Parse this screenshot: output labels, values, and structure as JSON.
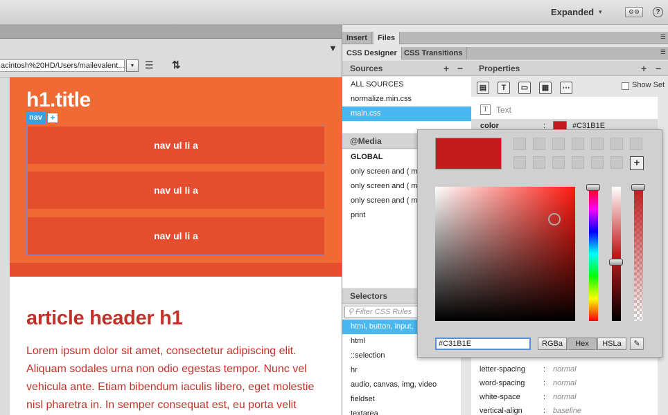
{
  "top": {
    "workspace_label": "Expanded",
    "workspace_caret": "▾",
    "sync_icon": "⚙⚙",
    "help_icon": "?"
  },
  "document": {
    "path_value": "acintosh%20HD/Users/mailevalent...",
    "dropdown_glyph": "▾",
    "filter_glyph": "▼",
    "list_glyph": "☰",
    "sort_glyph": "⇅",
    "hero_title": "h1.title",
    "nav_tag": "nav",
    "nav_plus": "+",
    "nav_items": [
      "nav ul li a",
      "nav ul li a",
      "nav ul li a"
    ],
    "article_heading": "article header h1",
    "lorem_lines": [
      "Lorem ipsum dolor sit amet, consectetur adipiscing elit.",
      "Aliquam sodales urna non odio egestas tempor. Nunc vel",
      "vehicula ante. Etiam bibendum iaculis libero, eget molestie",
      "nisl pharetra in. In semper consequat est, eu porta velit"
    ]
  },
  "panel": {
    "tabs_row1": [
      "Insert",
      "Files"
    ],
    "tabs_row2": [
      "CSS Designer",
      "CSS Transitions"
    ],
    "menu_glyph": "☰",
    "sources": {
      "title": "Sources",
      "add": "+",
      "remove": "−",
      "items": [
        "ALL SOURCES",
        "normalize.min.css",
        "main.css"
      ]
    },
    "media": {
      "title": "@Media",
      "items": [
        "GLOBAL",
        "only screen and ( m",
        "only screen and ( m",
        "only screen and ( m",
        "print"
      ]
    },
    "selectors": {
      "title": "Selectors",
      "filter_placeholder": "Filter CSS Rules",
      "items": [
        "html, button, input,",
        "html",
        "::selection",
        "hr",
        "audio, canvas, img, video",
        "fieldset",
        "textarea"
      ]
    },
    "properties": {
      "title": "Properties",
      "add": "+",
      "remove": "−",
      "show_set_label": "Show Set",
      "section_label": "Text",
      "color_name": "color",
      "color_value": "#C31B1E",
      "rows": [
        {
          "name": "letter-spacing",
          "value": "normal"
        },
        {
          "name": "word-spacing",
          "value": "normal"
        },
        {
          "name": "white-space",
          "value": "normal"
        },
        {
          "name": "vertical-align",
          "value": "baseline"
        }
      ],
      "colon": ":"
    }
  },
  "picker": {
    "current_color": "#C31B1E",
    "hex_value": "#C31B1E",
    "modes": [
      "RGBa",
      "Hex",
      "HSLa"
    ],
    "active_mode": "Hex",
    "add_swatch": "+",
    "eyedropper_glyph": "✎",
    "lightness_level_pct": 56,
    "alpha_level_pct": 100
  },
  "colors": {
    "hero_orange": "#ef6a35",
    "nav_red": "#e54d2f",
    "article_red": "#c0332a",
    "selection_blue": "#4bb7f0",
    "nav_tag_blue": "#3aa0e0"
  }
}
